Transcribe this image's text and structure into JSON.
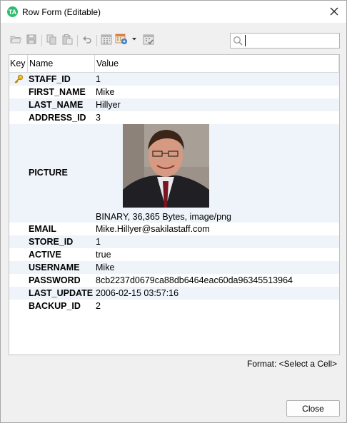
{
  "window": {
    "title": "Row Form (Editable)",
    "app_icon_glyph": "TA"
  },
  "toolbar": {
    "buttons": [
      {
        "name": "open-folder-icon"
      },
      {
        "name": "save-icon"
      },
      {
        "name": "copy-icon"
      },
      {
        "name": "paste-icon"
      },
      {
        "name": "undo-icon"
      },
      {
        "name": "calendar-icon"
      },
      {
        "name": "calendar-settings-icon"
      },
      {
        "name": "dropdown-arrow-icon"
      },
      {
        "name": "calendar-check-icon"
      }
    ]
  },
  "search": {
    "value": "",
    "placeholder": ""
  },
  "grid": {
    "headers": {
      "key": "Key",
      "name": "Name",
      "value": "Value"
    },
    "rows": [
      {
        "key": true,
        "name": "STAFF_ID",
        "value": "1"
      },
      {
        "key": false,
        "name": "FIRST_NAME",
        "value": "Mike"
      },
      {
        "key": false,
        "name": "LAST_NAME",
        "value": "Hillyer"
      },
      {
        "key": false,
        "name": "ADDRESS_ID",
        "value": "3"
      },
      {
        "key": false,
        "name": "PICTURE",
        "value": "BINARY, 36,365 Bytes, image/png"
      },
      {
        "key": false,
        "name": "EMAIL",
        "value": "Mike.Hillyer@sakilastaff.com"
      },
      {
        "key": false,
        "name": "STORE_ID",
        "value": "1"
      },
      {
        "key": false,
        "name": "ACTIVE",
        "value": "true"
      },
      {
        "key": false,
        "name": "USERNAME",
        "value": "Mike"
      },
      {
        "key": false,
        "name": "PASSWORD",
        "value": "8cb2237d0679ca88db6464eac60da96345513964"
      },
      {
        "key": false,
        "name": "LAST_UPDATE",
        "value": "2006-02-15 03:57:16"
      },
      {
        "key": false,
        "name": "BACKUP_ID",
        "value": "2"
      }
    ]
  },
  "footer": {
    "format_label": "Format: <Select a Cell>",
    "close_label": "Close"
  },
  "colors": {
    "accent": "#2ebd6b",
    "row_alt": "#eef4fa",
    "key_icon": "#d9a21b"
  }
}
